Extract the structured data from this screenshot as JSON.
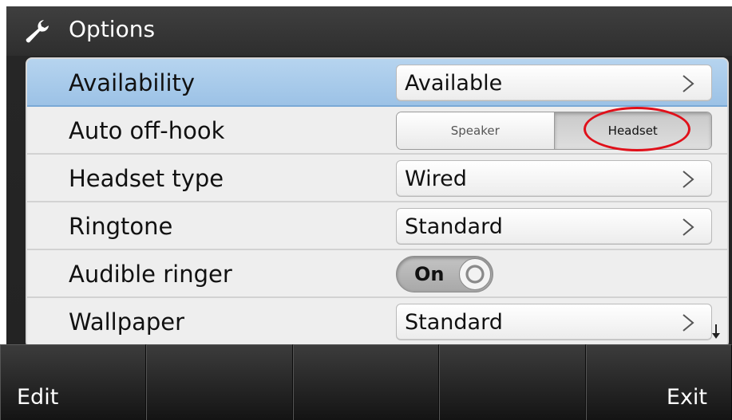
{
  "header": {
    "title": "Options",
    "icon": "wrench-icon"
  },
  "rows": [
    {
      "label": "Availability",
      "value": "Available",
      "control": "select"
    },
    {
      "label": "Auto off-hook",
      "control": "segmented",
      "options": [
        "Speaker",
        "Headset"
      ],
      "selected": "Headset"
    },
    {
      "label": "Headset type",
      "value": "Wired",
      "control": "select"
    },
    {
      "label": "Ringtone",
      "value": "Standard",
      "control": "select"
    },
    {
      "label": "Audible ringer",
      "control": "switch",
      "value": "On"
    },
    {
      "label": "Wallpaper",
      "value": "Standard",
      "control": "select"
    }
  ],
  "softkeys": [
    "Edit",
    "",
    "",
    "",
    "Exit"
  ],
  "colors": {
    "selection": "#9cc2e6",
    "annotation": "#e0101a",
    "background": "#262626"
  }
}
